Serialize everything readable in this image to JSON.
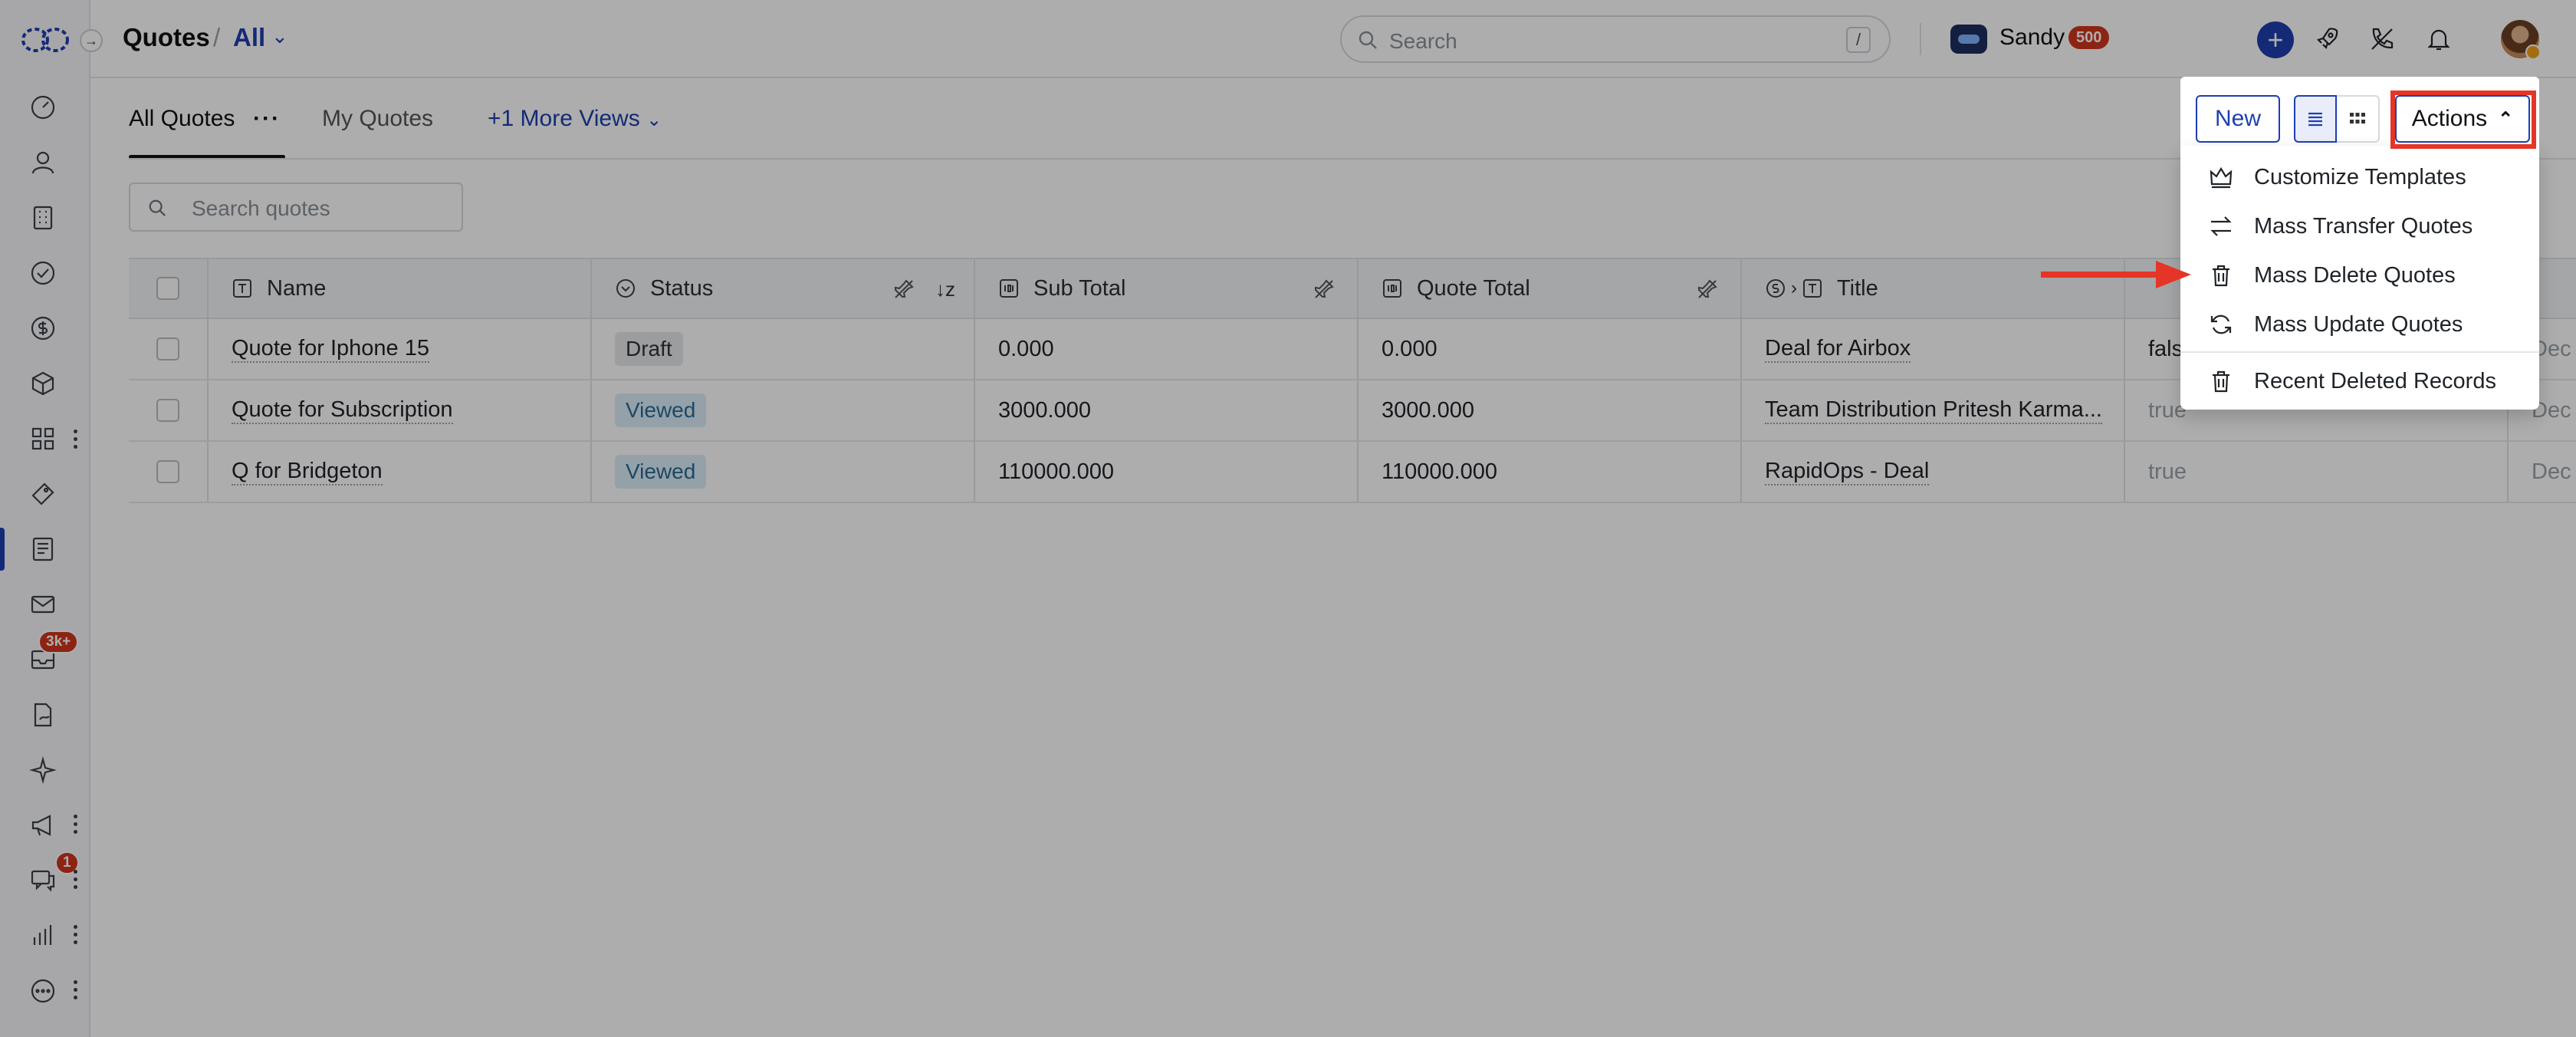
{
  "app": {
    "title": "Quotes",
    "view": "All",
    "search_placeholder": "Search",
    "search_shortcut": "/",
    "user_name": "Sandy",
    "user_badge": "500"
  },
  "sidebar": {
    "badges": {
      "inbox": "3k+",
      "chat": "1"
    }
  },
  "views": {
    "tabs": [
      {
        "label": "All Quotes"
      },
      {
        "label": "My Quotes"
      },
      {
        "label": "+1 More Views"
      }
    ],
    "more_label": "···",
    "search_placeholder": "Search quotes"
  },
  "toolbar": {
    "new_label": "New",
    "actions_label": "Actions"
  },
  "actions_menu": {
    "items": [
      {
        "label": "Customize Templates",
        "icon": "crown-icon"
      },
      {
        "label": "Mass Transfer Quotes",
        "icon": "transfer-icon"
      },
      {
        "label": "Mass Delete Quotes",
        "icon": "trash-icon"
      },
      {
        "label": "Mass Update Quotes",
        "icon": "refresh-icon"
      },
      {
        "label": "Recent Deleted Records",
        "icon": "trash-icon"
      }
    ]
  },
  "table": {
    "columns": [
      "Name",
      "Status",
      "Sub Total",
      "Quote Total",
      "Title"
    ],
    "rows": [
      {
        "name": "Quote for Iphone 15",
        "status": "Draft",
        "sub_total": "0.000",
        "quote_total": "0.000",
        "title": "Deal for Airbox",
        "extra": "fals",
        "date": "Dec"
      },
      {
        "name": "Quote for Subscription",
        "status": "Viewed",
        "sub_total": "3000.000",
        "quote_total": "3000.000",
        "title": "Team Distribution Pritesh Karma...",
        "extra": "true",
        "date": "Dec"
      },
      {
        "name": "Q for Bridgeton",
        "status": "Viewed",
        "sub_total": "110000.000",
        "quote_total": "110000.000",
        "title": "RapidOps - Deal",
        "extra": "true",
        "date": "Dec"
      }
    ]
  },
  "colors": {
    "accent": "#1e3fb0",
    "highlight": "#e53526",
    "badge": "#d0361c"
  }
}
